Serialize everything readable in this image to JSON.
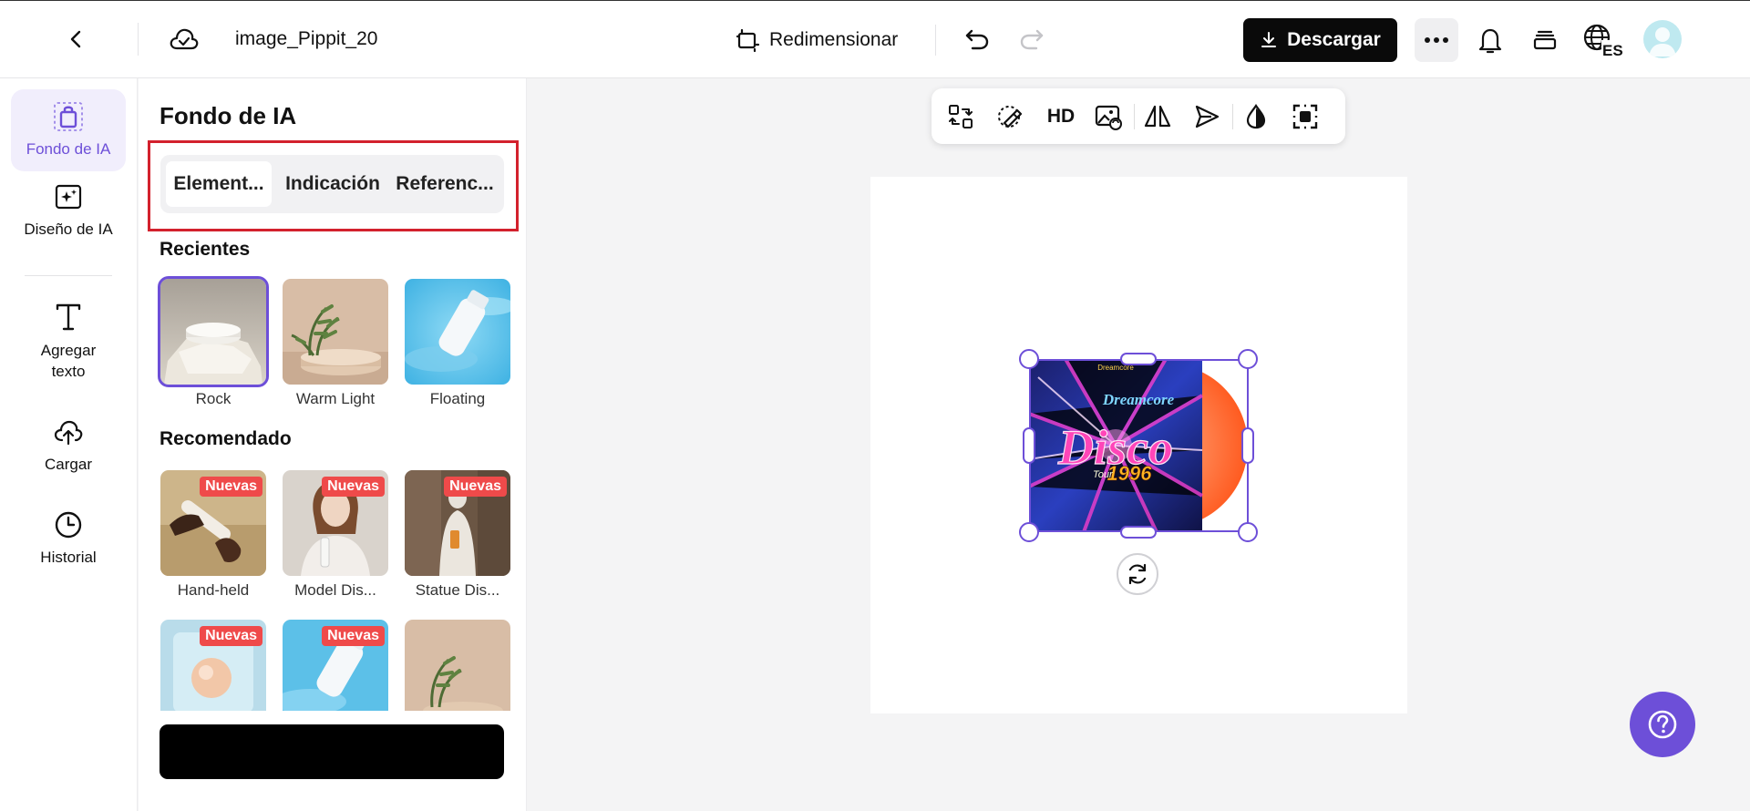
{
  "header": {
    "filename": "image_Pippit_20",
    "resize_label": "Redimensionar",
    "download_label": "Descargar",
    "lang_code": "ES"
  },
  "rail": {
    "items": [
      {
        "label": "Fondo de IA",
        "icon": "bag-icon",
        "active": true
      },
      {
        "label": "Diseño de IA",
        "icon": "sparkle-image-icon"
      },
      {
        "label": "Agregar texto",
        "icon": "text-icon"
      },
      {
        "label": "Cargar",
        "icon": "upload-cloud-icon"
      },
      {
        "label": "Historial",
        "icon": "clock-icon"
      }
    ]
  },
  "panel": {
    "title": "Fondo de IA",
    "tabs": [
      {
        "label": "Element..."
      },
      {
        "label": "Indicación"
      },
      {
        "label": "Referenc..."
      }
    ],
    "recent_title": "Recientes",
    "recent": [
      {
        "label": "Rock"
      },
      {
        "label": "Warm Light"
      },
      {
        "label": "Floating"
      }
    ],
    "recommended_title": "Recomendado",
    "recommended": [
      {
        "label": "Hand-held",
        "badge": "Nuevas"
      },
      {
        "label": "Model Dis...",
        "badge": "Nuevas"
      },
      {
        "label": "Statue Dis...",
        "badge": "Nuevas"
      },
      {
        "badge": "Nuevas"
      },
      {
        "badge": "Nuevas"
      },
      {}
    ]
  },
  "toolbar": {
    "hd_label": "HD"
  },
  "colors": {
    "accent": "#6d4fd8",
    "highlight": "#d3212d",
    "badge": "#ef4a4a"
  }
}
